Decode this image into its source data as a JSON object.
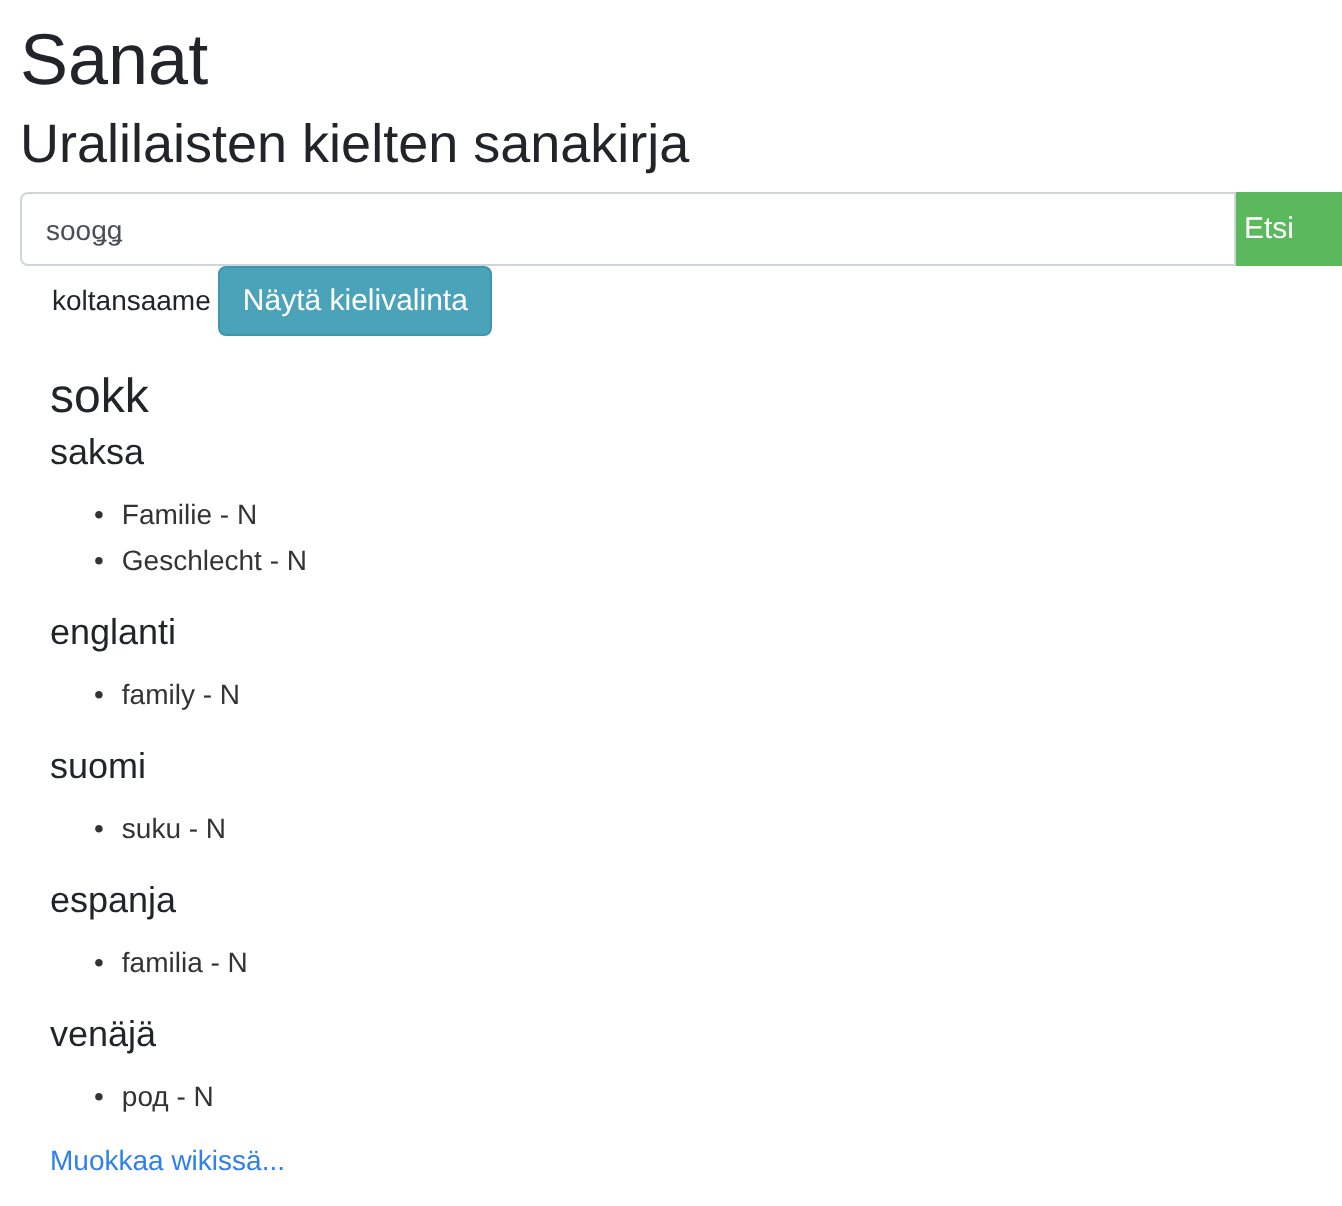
{
  "title": "Sanat",
  "subtitle": "Uralilaisten kielten sanakirja",
  "search": {
    "value": "sooǥǥ",
    "button": "Etsi"
  },
  "language": {
    "label": "koltansaame",
    "button": "Näytä kielivalinta"
  },
  "entry": {
    "word": "sokk",
    "bullet": "•",
    "groups": [
      {
        "language": "saksa",
        "translations": [
          "Familie - N",
          "Geschlecht - N"
        ]
      },
      {
        "language": "englanti",
        "translations": [
          "family - N"
        ]
      },
      {
        "language": "suomi",
        "translations": [
          "suku - N"
        ]
      },
      {
        "language": "espanja",
        "translations": [
          "familia - N"
        ]
      },
      {
        "language": "venäjä",
        "translations": [
          "род - N"
        ]
      }
    ]
  },
  "edit_link": "Muokkaa wikissä..."
}
